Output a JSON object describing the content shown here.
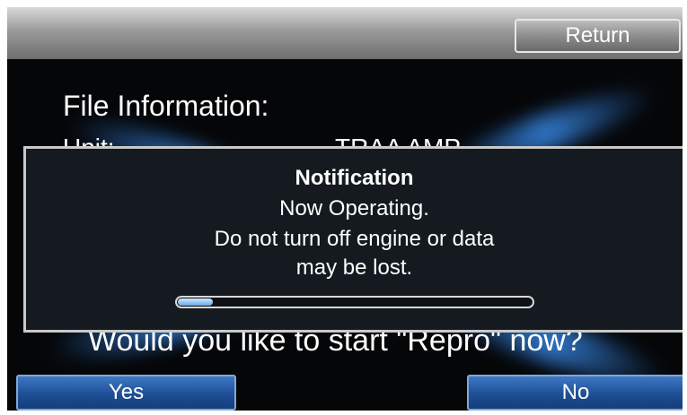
{
  "topbar": {
    "return_label": "Return"
  },
  "main": {
    "heading": "File Information:",
    "unit_label": "Unit:",
    "unit_value": "TRAA AMP",
    "question": "Would you like to start \"Repro\" now?"
  },
  "dialog": {
    "title": "Notification",
    "line1": "Now Operating.",
    "line2": "Do not turn off engine or data",
    "line3": "may be lost.",
    "progress_fraction": 0.1
  },
  "buttons": {
    "yes_label": "Yes",
    "no_label": "No"
  },
  "colors": {
    "button_blue": "#1e4f96",
    "progress": "#6aa8e8"
  }
}
